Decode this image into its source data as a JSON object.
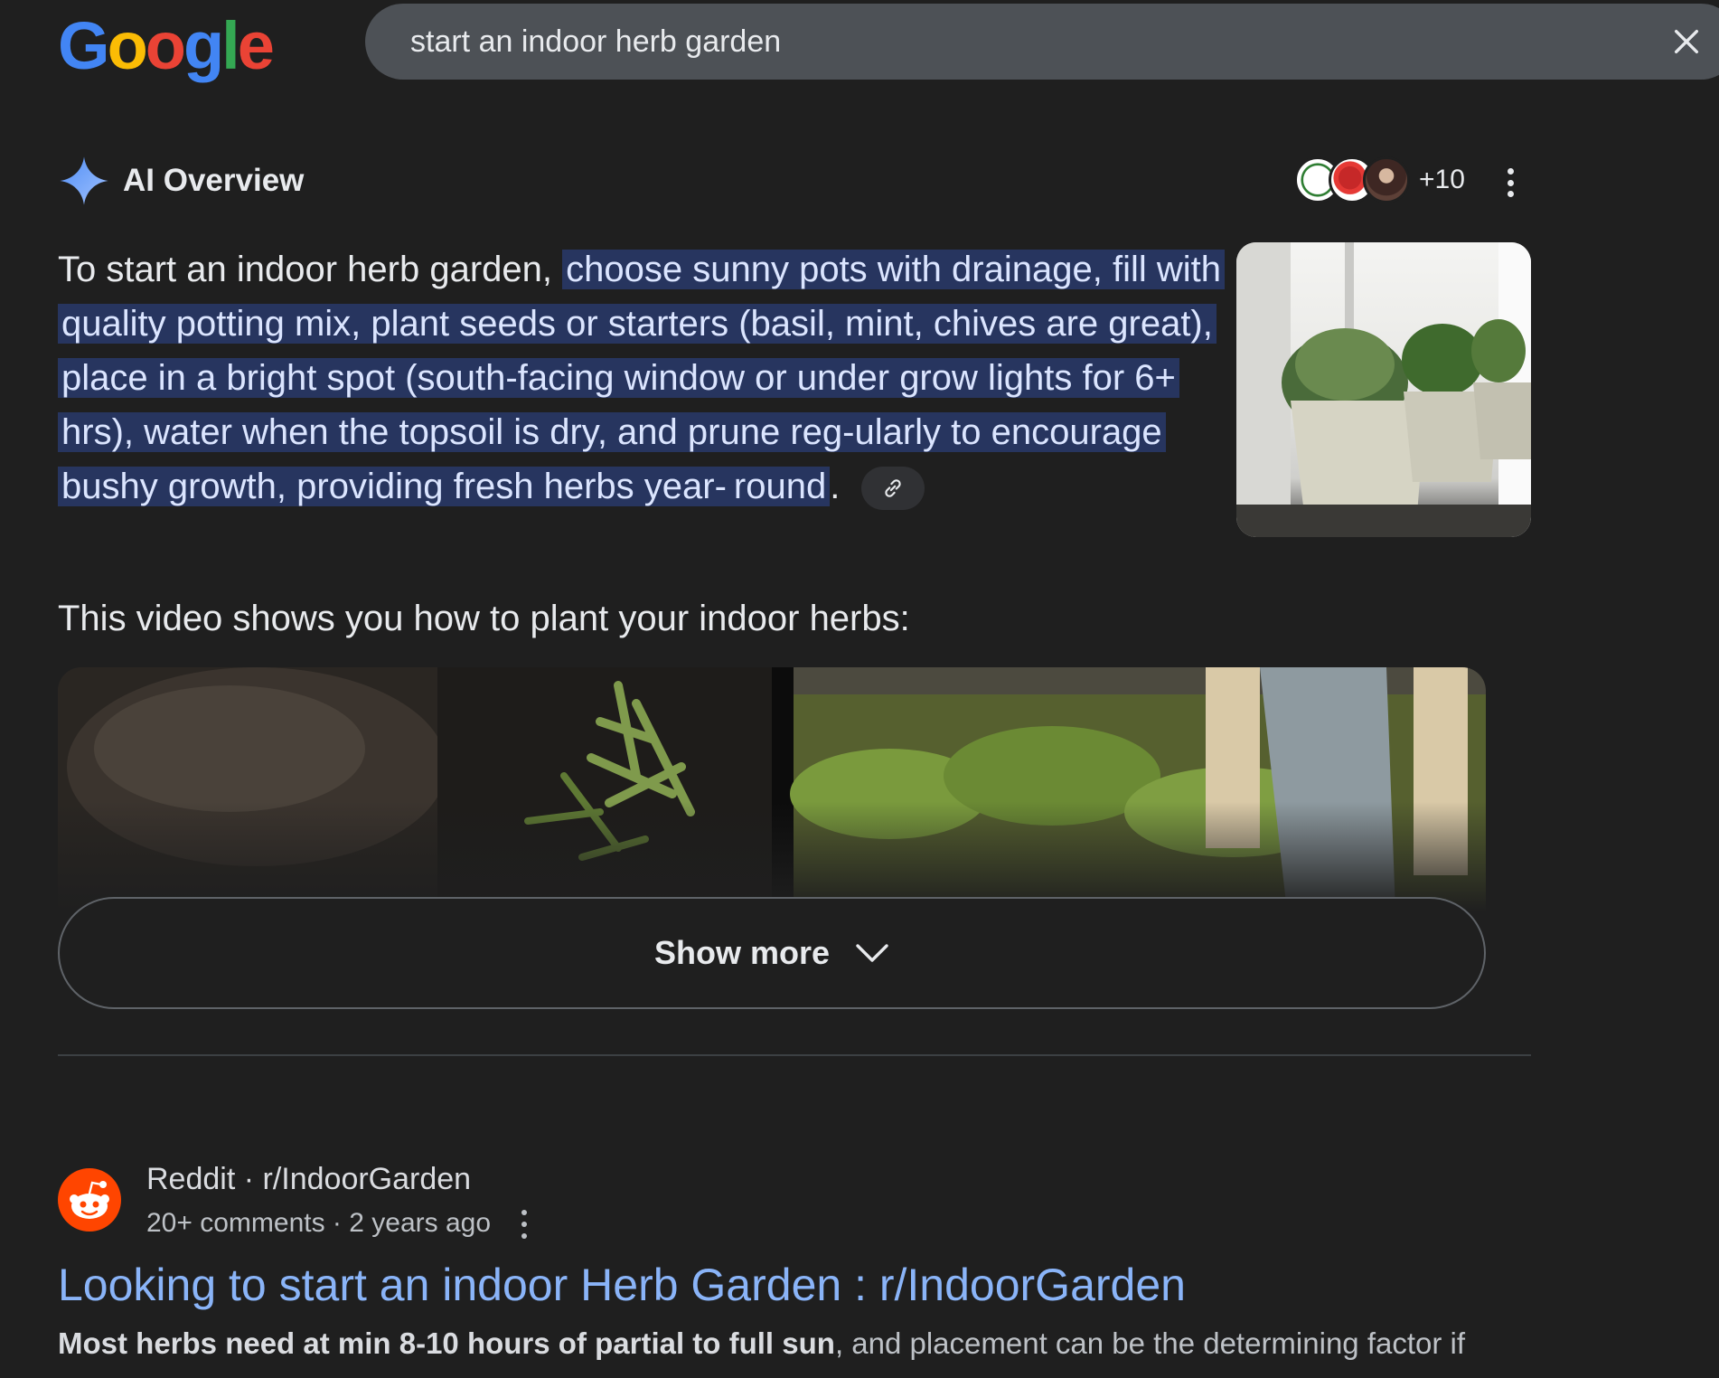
{
  "header": {
    "logo_letters": [
      {
        "char": "G",
        "color": "#4285f4"
      },
      {
        "char": "o",
        "color": "#fbbc05"
      },
      {
        "char": "o",
        "color": "#ea4335"
      },
      {
        "char": "g",
        "color": "#4285f4"
      },
      {
        "char": "l",
        "color": "#34a853"
      },
      {
        "char": "e",
        "color": "#ea4335"
      }
    ],
    "search_query": "start an indoor herb garden",
    "clear_icon": "close-icon"
  },
  "ai_overview": {
    "title": "AI Overview",
    "sparkle_icon": "gemini-sparkle-icon",
    "sources_more": "+10",
    "text_lead": "To start an indoor herb garden, ",
    "text_highlight_1": "choose sunny pots with drainage, fill with quality potting mix, plant seeds or starters (basil, mint, chives are great), place in a bright spot (south-facing window or under grow lights for 6+ hrs), water when the topsoil is dry, and prune reg-ularly to encourage bushy growth, providing fresh herbs year-",
    "text_highlight_2": "round",
    "text_end": ".",
    "link_icon": "link-icon",
    "video_intro": "This video shows you how to plant your indoor herbs:",
    "show_more_label": "Show more"
  },
  "result": {
    "site": "Reddit · r/IndoorGarden",
    "meta": "20+ comments · 2 years ago",
    "title": "Looking to start an indoor Herb Garden : r/IndoorGarden",
    "snippet_bold": "Most herbs need at min 8-10 hours of partial to full sun",
    "snippet_rest": ", and placement can be the determining factor if"
  },
  "colors": {
    "background": "#1f1f1f",
    "search_box": "#4d5156",
    "highlight": "#27355f",
    "link": "#8ab4f8",
    "reddit": "#ff4500"
  }
}
